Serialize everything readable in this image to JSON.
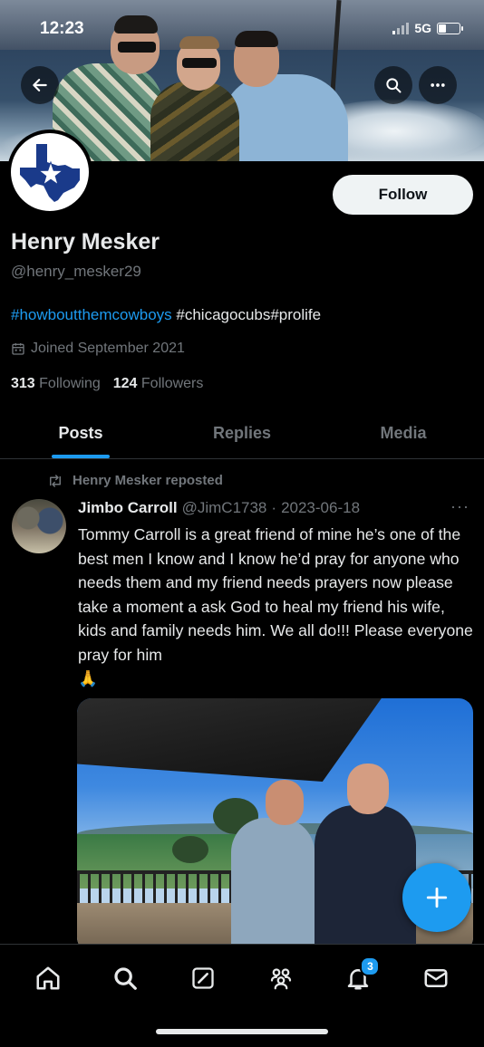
{
  "status_bar": {
    "time": "12:23",
    "network": "5G"
  },
  "profile": {
    "name": "Henry Mesker",
    "handle": "@henry_mesker29",
    "bio_tag_1": "#howboutthemcowboys",
    "bio_tag_2": " #chicagocubs#prolife",
    "joined": "Joined September 2021",
    "following_count": "313",
    "following_label": "Following",
    "followers_count": "124",
    "followers_label": "Followers",
    "follow_label": "Follow"
  },
  "tabs": [
    {
      "label": "Posts",
      "active": true
    },
    {
      "label": "Replies",
      "active": false
    },
    {
      "label": "Media",
      "active": false
    }
  ],
  "post": {
    "repost_label": "Henry Mesker reposted",
    "author_name": "Jimbo Carroll",
    "author_handle": "@JimC1738",
    "separator": "·",
    "date": "2023-06-18",
    "more": "···",
    "text": "Tommy Carroll is a great friend of mine he’s one of the best men I know and I know he’d pray for anyone who needs them and my friend needs prayers now please take a moment a ask God to heal my friend his wife, kids and family needs him. We all do!!! Please everyone pray for him",
    "emoji": "🙏"
  },
  "nav": {
    "notifications_badge": "3",
    "items": [
      "home-icon",
      "search-icon",
      "grok-icon",
      "communities-icon",
      "notifications-icon",
      "messages-icon"
    ]
  },
  "colors": {
    "accent": "#1d9bf0",
    "background": "#000000",
    "text": "#e7e9ea",
    "muted": "#71767b"
  }
}
